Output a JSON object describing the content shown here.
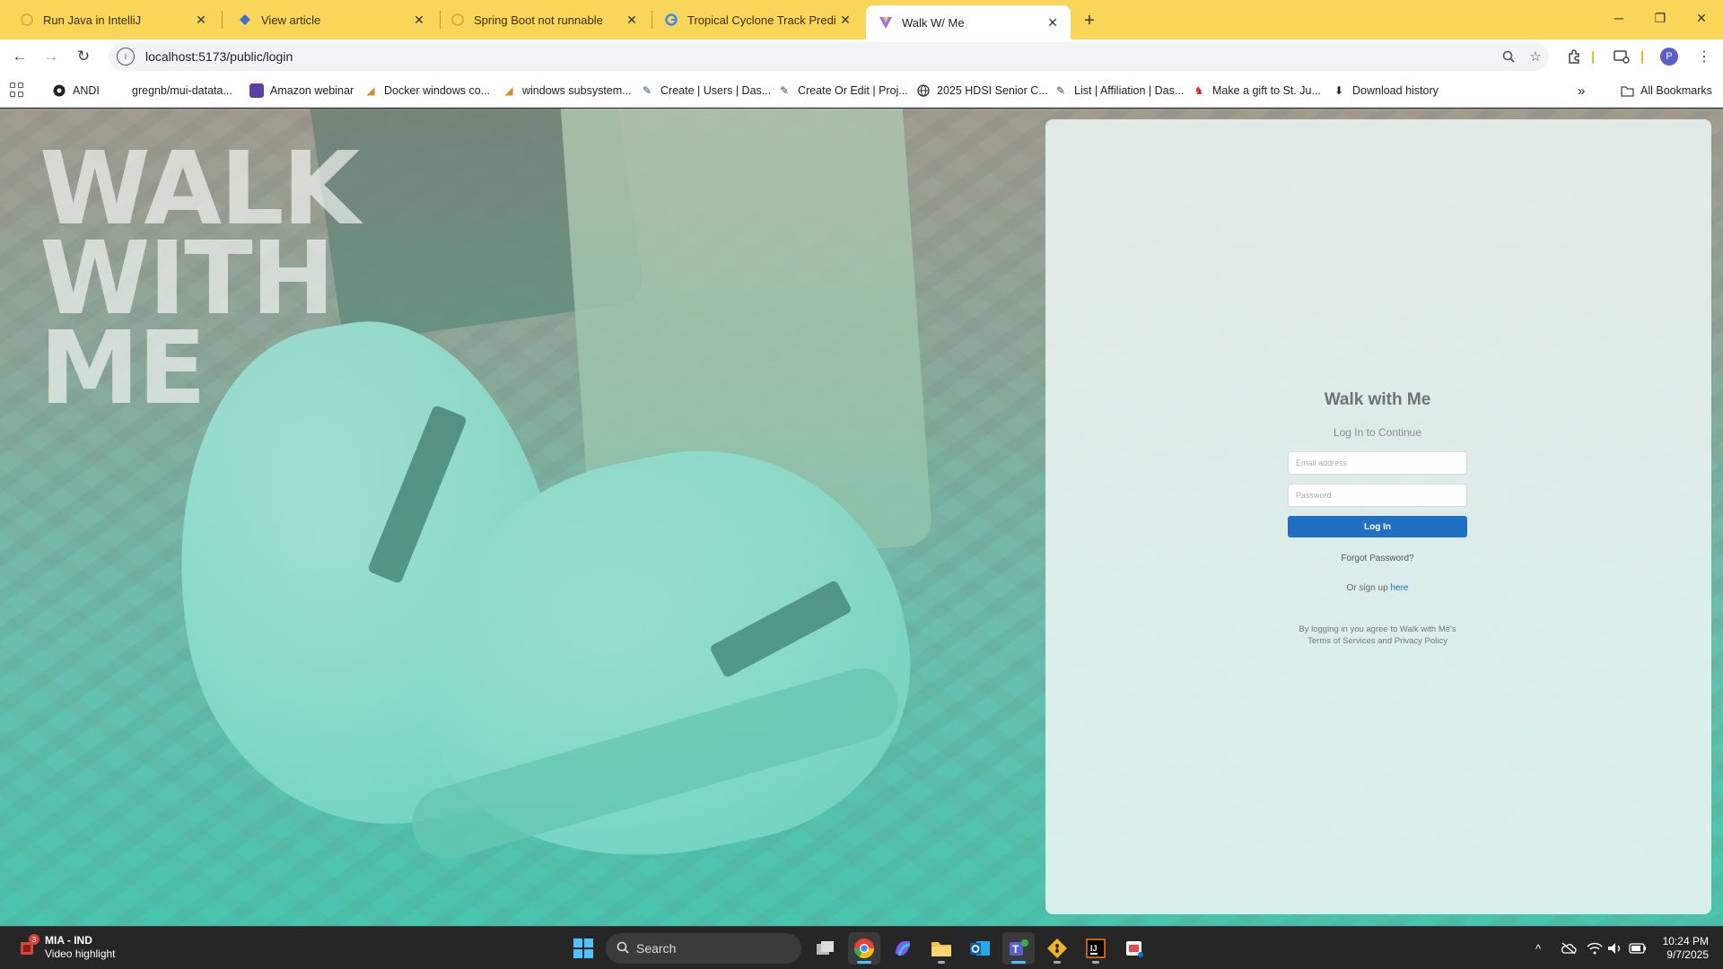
{
  "browser": {
    "tabs": [
      {
        "title": "Run Java in IntelliJ",
        "icon": "generic-page-icon",
        "active": false
      },
      {
        "title": "View article",
        "icon": "diamond-page-icon",
        "active": false
      },
      {
        "title": "Spring Boot not runnable",
        "icon": "generic-page-icon",
        "active": false
      },
      {
        "title": "Tropical Cyclone Track Predictio",
        "icon": "google-icon",
        "active": false
      },
      {
        "title": "Walk W/ Me",
        "icon": "vite-icon",
        "active": true
      }
    ],
    "new_tab": "+",
    "address": "localhost:5173/public/login",
    "profile_initial": "P",
    "bookmarks": [
      {
        "label": "ANDI",
        "icon": "andi-icon"
      },
      {
        "label": "gregnb/mui-datata...",
        "icon": "github-icon"
      },
      {
        "label": "Amazon webinar",
        "icon": "webinar-icon"
      },
      {
        "label": "Docker windows co...",
        "icon": "bookmark-page-icon"
      },
      {
        "label": "windows subsystem...",
        "icon": "bookmark-page-icon"
      },
      {
        "label": "Create | Users | Das...",
        "icon": "dashboard-icon"
      },
      {
        "label": "Create Or Edit | Proj...",
        "icon": "dashboard-icon"
      },
      {
        "label": "2025 HDSI Senior C...",
        "icon": "globe-icon"
      },
      {
        "label": "List | Affiliation | Das...",
        "icon": "dashboard-icon"
      },
      {
        "label": "Make a gift to St. Ju...",
        "icon": "st-jude-icon"
      },
      {
        "label": "Download history",
        "icon": "download-icon"
      }
    ],
    "overflow": "»",
    "all_bookmarks": "All Bookmarks"
  },
  "hero": {
    "line1": "WALK",
    "line2": "WITH",
    "line3": "ME"
  },
  "login": {
    "app_title": "Walk with Me",
    "subtitle": "Log In to Continue",
    "email_placeholder": "Email address",
    "password_placeholder": "Password",
    "login_button": "Log In",
    "forgot_password": "Forgot Password?",
    "signup_prefix": "Or sign up",
    "signup_link": "here",
    "legal_line1": "By logging in you agree to Walk with Me's",
    "legal_line2": "Terms of Services and Privacy Policy"
  },
  "taskbar": {
    "weather_badge": "3",
    "weather_line1": "MIA - IND",
    "weather_line2": "Video highlight",
    "search_label": "Search",
    "time": "10:24 PM",
    "date": "9/7/2025"
  },
  "colors": {
    "tab_strip": "#f9d65a",
    "accent_button": "#1f6fc5",
    "teal_overlay": "#4cc1ac"
  }
}
